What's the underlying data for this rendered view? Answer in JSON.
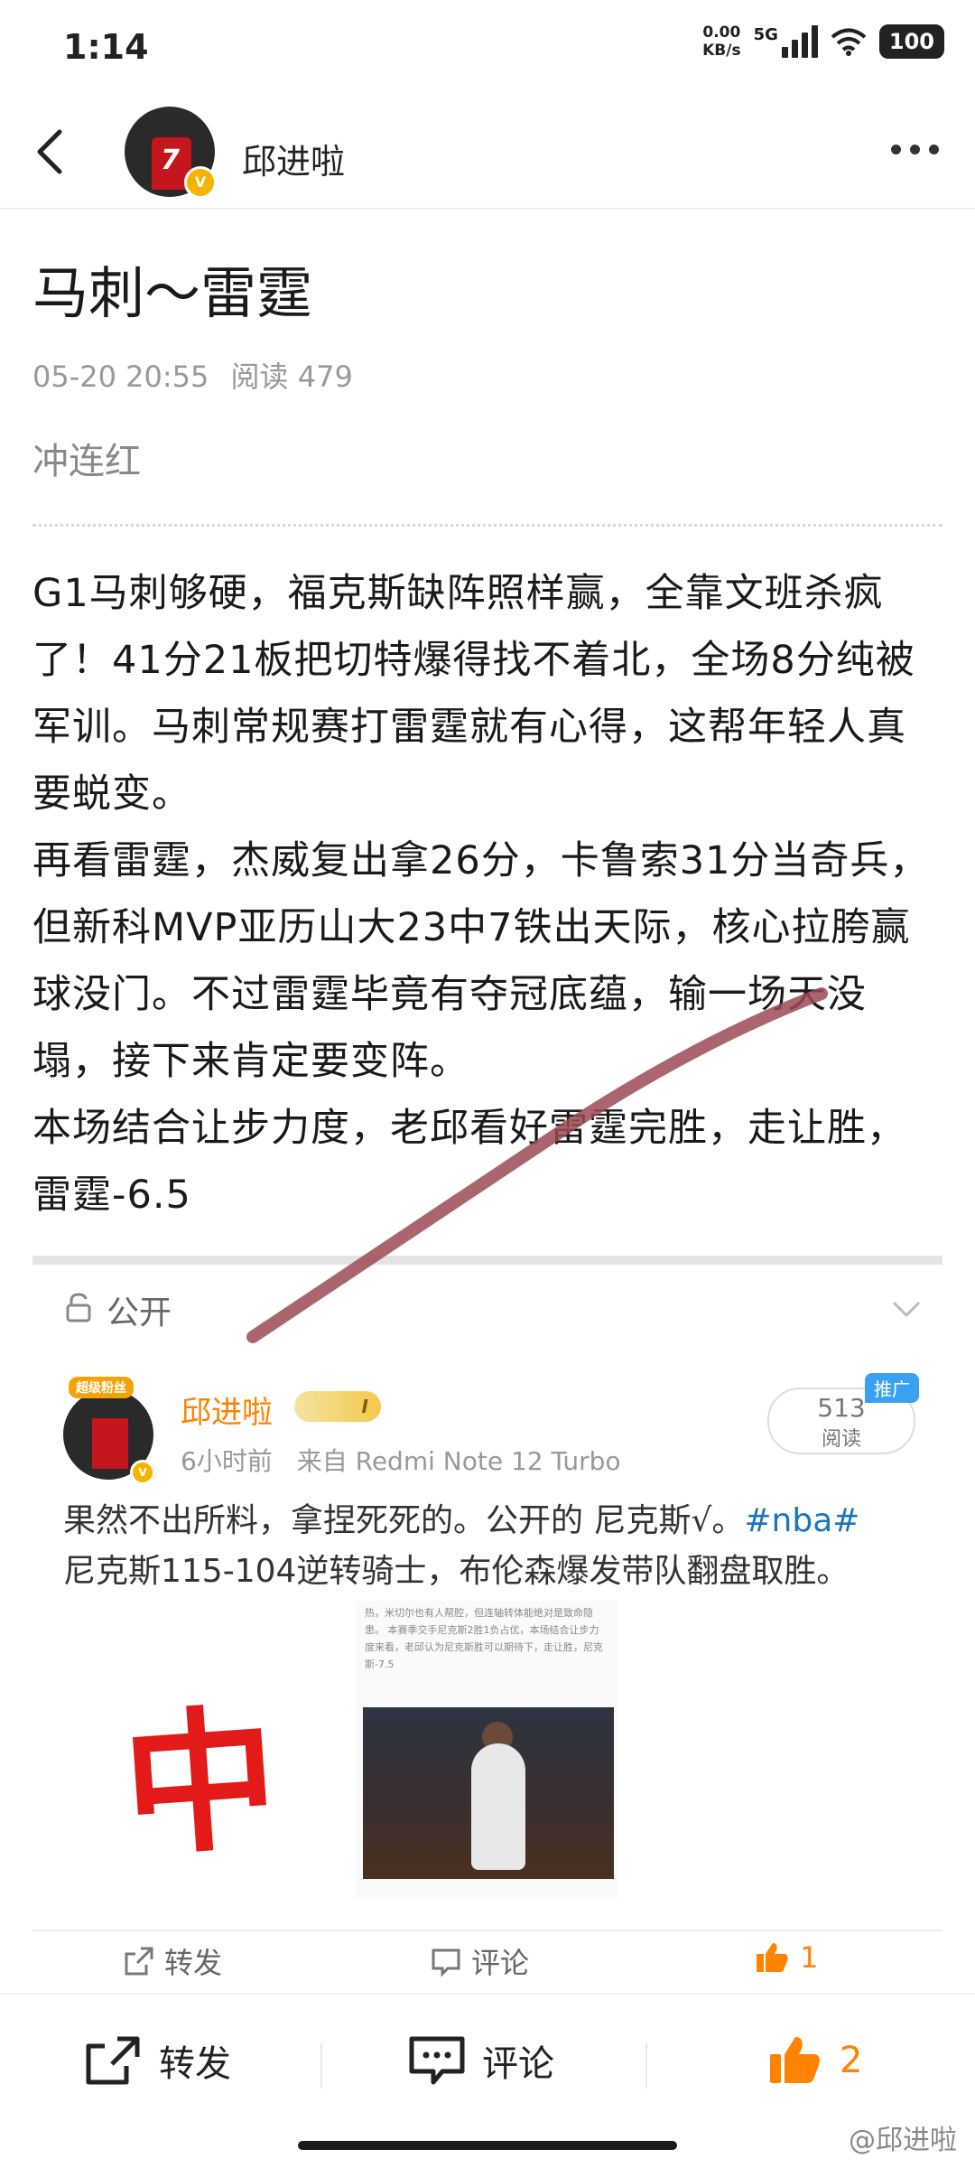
{
  "status_bar": {
    "time": "1:14",
    "net_speed_value": "0.00",
    "net_speed_unit": "KB/s",
    "network": "5G",
    "battery": "100"
  },
  "nav": {
    "author_name": "邱进啦"
  },
  "article": {
    "title": "马刺～雷霆",
    "date": "05-20 20:55",
    "read_label": "阅读",
    "read_count": "479",
    "subtitle": "冲连红",
    "paragraphs": [
      "G1马刺够硬，福克斯缺阵照样赢，全靠文班杀疯了！41分21板把切特爆得找不着北，全场8分纯被军训。马刺常规赛打雷霆就有心得，这帮年轻人真要蜕变。",
      "再看雷霆，杰威复出拿26分，卡鲁索31分当奇兵，但新科MVP亚历山大23中7铁出天际，核心拉胯赢球没门。不过雷霆毕竟有夺冠底蕴，输一场天没塌，接下来肯定要变阵。",
      "本场结合让步力度，老邱看好雷霆完胜，走让胜，雷霆-6.5"
    ]
  },
  "visibility": {
    "label": "公开"
  },
  "embedded_post": {
    "avatar_badge": "超级粉丝",
    "author": "邱进啦",
    "level": "I",
    "time": "6小时前",
    "source": "来自 Redmi Note 12 Turbo",
    "read_count": "513",
    "read_label": "阅读",
    "promo_label": "推广",
    "text_main": "果然不出所料，拿捏死死的。公开的 尼克斯√。",
    "hashtag": "#nba#",
    "text_second": "尼克斯115-104逆转骑士，布伦森爆发带队翻盘取胜。",
    "stamp": "中",
    "mini_text": "热，米切尔也有人帮腔，但连轴转体能绝对是致命隐患。 本赛季交手尼克斯2胜1负占优，本场结合让步力度来看，老邱认为尼克斯胜可以期待下，走让胜，尼克斯-7.5",
    "actions": {
      "repost": "转发",
      "comment": "评论",
      "like_count": "1"
    }
  },
  "bottom_bar": {
    "repost": "转发",
    "comment": "评论",
    "like_count": "2"
  },
  "watermark": "@邱进啦",
  "colors": {
    "accent_orange": "#ff8200",
    "link_blue": "#1a74c0",
    "stroke_mark": "#9c4a55"
  }
}
